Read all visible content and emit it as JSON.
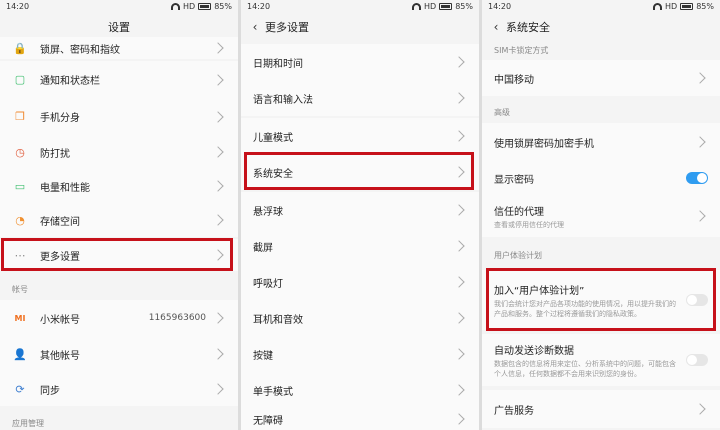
{
  "status": {
    "time": "14:20",
    "net": "HD",
    "battery": "85%"
  },
  "panel1": {
    "title": "设置",
    "items": [
      {
        "label": "锁屏、密码和指纹",
        "icon": "🔒",
        "color": "#f0a030"
      },
      {
        "label": "通知和状态栏",
        "icon": "▢",
        "color": "#3fbf6f"
      },
      {
        "label": "手机分身",
        "icon": "❐",
        "color": "#f08a30"
      },
      {
        "label": "防打扰",
        "icon": "◷",
        "color": "#e05a3a"
      },
      {
        "label": "电量和性能",
        "icon": "▭",
        "color": "#3fbf6f"
      },
      {
        "label": "存储空间",
        "icon": "◔",
        "color": "#f09030"
      },
      {
        "label": "更多设置",
        "icon": "⋯",
        "color": "#888888"
      }
    ],
    "section_account": "帐号",
    "account_items": [
      {
        "label": "小米帐号",
        "icon": "MI",
        "value": "1165963600",
        "color": "#f07020"
      },
      {
        "label": "其他帐号",
        "icon": "👤",
        "value": "",
        "color": "#3f7fd0"
      },
      {
        "label": "同步",
        "icon": "⟳",
        "value": "",
        "color": "#3f7fd0"
      }
    ],
    "section_apps": "应用管理"
  },
  "panel2": {
    "title": "更多设置",
    "items": [
      {
        "label": "日期和时间"
      },
      {
        "label": "语言和输入法"
      },
      {
        "label": "儿童模式"
      },
      {
        "label": "系统安全"
      },
      {
        "label": "悬浮球"
      },
      {
        "label": "截屏"
      },
      {
        "label": "呼吸灯"
      },
      {
        "label": "耳机和音效"
      },
      {
        "label": "按键"
      },
      {
        "label": "单手模式"
      },
      {
        "label": "无障碍"
      }
    ]
  },
  "panel3": {
    "title": "系统安全",
    "sim_section": "SIM卡锁定方式",
    "carrier": "中国移动",
    "section_advanced": "高级",
    "encrypt": "使用锁屏密码加密手机",
    "show_password": "显示密码",
    "trust_title": "信任的代理",
    "trust_sub": "查看或停用信任的代理",
    "section_ux": "用户体验计划",
    "join_title": "加入“用户体验计划”",
    "join_sub": "我们会统计您对产品各项功能的使用情况，用以提升我们的产品和服务。整个过程将遵循我们的隐私政策。",
    "auto_title": "自动发送诊断数据",
    "auto_sub": "数据包含的信息将用来定位、分析系统中的问题，可能包含个人信息，任何数据都不会用来识别您的身份。",
    "ads": "广告服务"
  },
  "colors": {
    "highlight": "#c6111a",
    "toggle_on": "#2f9cf0"
  }
}
